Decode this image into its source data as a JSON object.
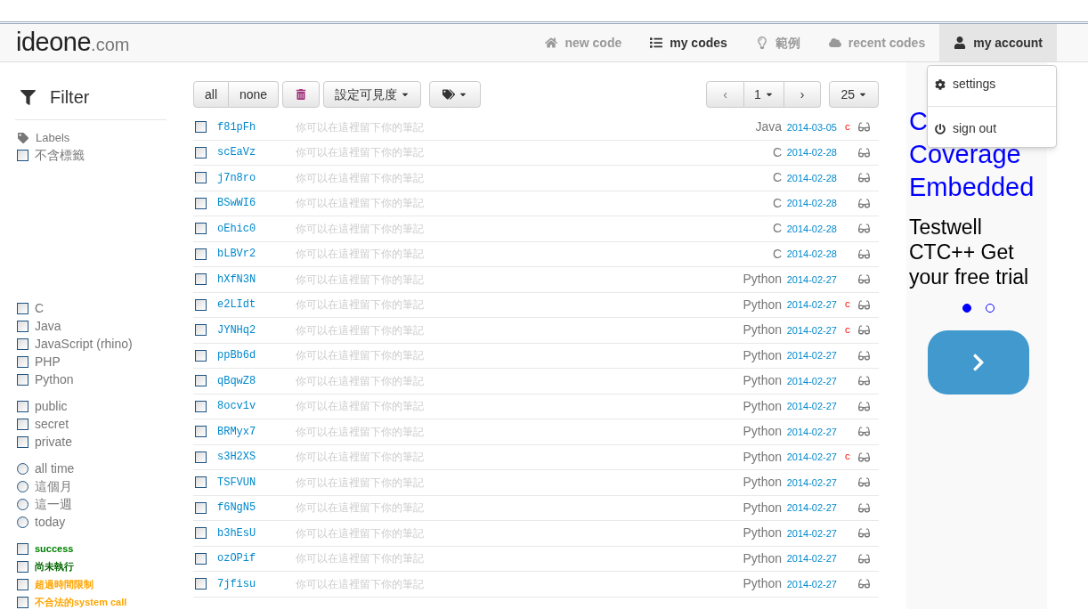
{
  "logo": {
    "name": "ideone",
    "suffix": ".com"
  },
  "nav": [
    {
      "label": "new code",
      "selected": false,
      "expanded": false
    },
    {
      "label": "my codes",
      "selected": true,
      "expanded": false
    },
    {
      "label": "範例",
      "selected": false,
      "expanded": false
    },
    {
      "label": "recent codes",
      "selected": false,
      "expanded": false
    },
    {
      "label": "my account",
      "selected": true,
      "expanded": true
    }
  ],
  "account_menu": [
    {
      "label": "settings"
    },
    {
      "label": "sign out"
    }
  ],
  "filter": {
    "title": "Filter",
    "labels_heading": "Labels",
    "groups": [
      [
        {
          "label": "不含標籤",
          "kind": "checkbox",
          "checked": false
        }
      ],
      [
        {
          "label": "C",
          "kind": "checkbox",
          "checked": false
        },
        {
          "label": "Java",
          "kind": "checkbox",
          "checked": false
        },
        {
          "label": "JavaScript (rhino)",
          "kind": "checkbox",
          "checked": false
        },
        {
          "label": "PHP",
          "kind": "checkbox",
          "checked": false
        },
        {
          "label": "Python",
          "kind": "checkbox",
          "checked": false
        }
      ],
      [
        {
          "label": "public",
          "kind": "checkbox",
          "checked": false
        },
        {
          "label": "secret",
          "kind": "checkbox",
          "checked": false
        },
        {
          "label": "private",
          "kind": "checkbox",
          "checked": false
        }
      ],
      [
        {
          "label": "all time",
          "kind": "radio",
          "checked": false
        },
        {
          "label": "這個月",
          "kind": "radio",
          "checked": false
        },
        {
          "label": "這一週",
          "kind": "radio",
          "checked": false
        },
        {
          "label": "today",
          "kind": "radio",
          "checked": false
        }
      ],
      [
        {
          "label": "success",
          "kind": "checkbox",
          "checked": false,
          "color": "#008000"
        },
        {
          "label": "尚未執行",
          "kind": "checkbox",
          "checked": false,
          "color": "#006400"
        },
        {
          "label": "超過時間限制",
          "kind": "checkbox",
          "checked": false,
          "color": "#ffa500"
        },
        {
          "label": "不合法的system call",
          "kind": "checkbox",
          "checked": false,
          "color": "#ffa500"
        }
      ]
    ]
  },
  "toolbar": {
    "all": "all",
    "none": "none",
    "visibility": "設定可見度",
    "prev": "‹",
    "page": "1",
    "next": "›",
    "per_page": "25"
  },
  "codes": [
    {
      "id": "f81pFh",
      "note": "你可以在這裡留下你的筆記",
      "language": "Java",
      "date": "2014-03-05",
      "flag": "c",
      "checked": false
    },
    {
      "id": "scEaVz",
      "note": "你可以在這裡留下你的筆記",
      "language": "C",
      "date": "2014-02-28",
      "checked": false
    },
    {
      "id": "j7n8ro",
      "note": "你可以在這裡留下你的筆記",
      "language": "C",
      "date": "2014-02-28",
      "checked": false
    },
    {
      "id": "BSwWI6",
      "note": "你可以在這裡留下你的筆記",
      "language": "C",
      "date": "2014-02-28",
      "checked": false
    },
    {
      "id": "oEhic0",
      "note": "你可以在這裡留下你的筆記",
      "language": "C",
      "date": "2014-02-28",
      "checked": false
    },
    {
      "id": "bLBVr2",
      "note": "你可以在這裡留下你的筆記",
      "language": "C",
      "date": "2014-02-28",
      "checked": false
    },
    {
      "id": "hXfN3N",
      "note": "你可以在這裡留下你的筆記",
      "language": "Python",
      "date": "2014-02-27",
      "checked": false
    },
    {
      "id": "e2LIdt",
      "note": "你可以在這裡留下你的筆記",
      "language": "Python",
      "date": "2014-02-27",
      "flag": "c",
      "checked": false
    },
    {
      "id": "JYNHq2",
      "note": "你可以在這裡留下你的筆記",
      "language": "Python",
      "date": "2014-02-27",
      "flag": "c",
      "checked": false
    },
    {
      "id": "ppBb6d",
      "note": "你可以在這裡留下你的筆記",
      "language": "Python",
      "date": "2014-02-27",
      "checked": false
    },
    {
      "id": "qBqwZ8",
      "note": "你可以在這裡留下你的筆記",
      "language": "Python",
      "date": "2014-02-27",
      "checked": false
    },
    {
      "id": "8ocv1v",
      "note": "你可以在這裡留下你的筆記",
      "language": "Python",
      "date": "2014-02-27",
      "checked": false
    },
    {
      "id": "BRMyx7",
      "note": "你可以在這裡留下你的筆記",
      "language": "Python",
      "date": "2014-02-27",
      "checked": false
    },
    {
      "id": "s3H2XS",
      "note": "你可以在這裡留下你的筆記",
      "language": "Python",
      "date": "2014-02-27",
      "flag": "c",
      "checked": false
    },
    {
      "id": "TSFVUN",
      "note": "你可以在這裡留下你的筆記",
      "language": "Python",
      "date": "2014-02-27",
      "checked": false
    },
    {
      "id": "f6NgN5",
      "note": "你可以在這裡留下你的筆記",
      "language": "Python",
      "date": "2014-02-27",
      "checked": false
    },
    {
      "id": "b3hEsU",
      "note": "你可以在這裡留下你的筆記",
      "language": "Python",
      "date": "2014-02-27",
      "checked": false
    },
    {
      "id": "ozOPif",
      "note": "你可以在這裡留下你的筆記",
      "language": "Python",
      "date": "2014-02-27",
      "checked": false
    },
    {
      "id": "7jfisu",
      "note": "你可以在這裡留下你的筆記",
      "language": "Python",
      "date": "2014-02-27",
      "checked": false
    }
  ],
  "ad": {
    "headline": [
      "C",
      "Coverage",
      "Embedded"
    ],
    "body": "Testwell CTC++ Get your free trial",
    "slides": [
      {
        "selected": true
      },
      {
        "selected": false
      }
    ]
  }
}
